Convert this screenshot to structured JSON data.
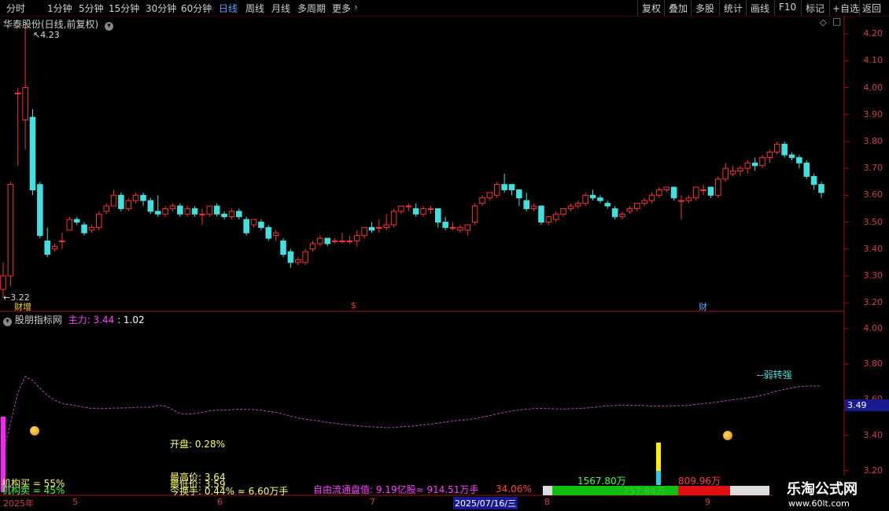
{
  "toolbar": {
    "periods": [
      "分时",
      "1分钟",
      "5分钟",
      "15分钟",
      "30分钟",
      "60分钟",
      "日线",
      "周线",
      "月线",
      "多周期",
      "更多"
    ],
    "active_period": "日线",
    "right_buttons": [
      "复权",
      "叠加",
      "多股",
      "统计",
      "画线",
      "F10",
      "标记",
      "+自选",
      "返回"
    ]
  },
  "main_chart": {
    "title": "华泰股份(日线,前复权)",
    "y_ticks": [
      "4.20",
      "4.10",
      "4.00",
      "3.90",
      "3.80",
      "3.70",
      "3.60",
      "3.50",
      "3.40",
      "3.30",
      "3.20"
    ],
    "high_label": "4.23",
    "low_label": "3.22",
    "markers": [
      {
        "text": "财增"
      },
      {
        "text": "$"
      },
      {
        "text": "财"
      }
    ],
    "colors": {
      "up": "#ff3030",
      "down": "#40e0e0",
      "axis": "#d04040",
      "bg": "#000000"
    }
  },
  "chart_data": {
    "type": "candlestick",
    "ylim": [
      3.18,
      4.25
    ],
    "candles": [
      [
        3.25,
        3.3,
        3.22,
        3.35
      ],
      [
        3.3,
        3.64,
        3.26,
        3.65
      ],
      [
        3.98,
        3.98,
        3.71,
        4.0
      ],
      [
        3.88,
        4.0,
        3.77,
        4.23
      ],
      [
        3.89,
        3.62,
        3.6,
        3.92
      ],
      [
        3.64,
        3.45,
        3.44,
        3.65
      ],
      [
        3.43,
        3.38,
        3.37,
        3.48
      ],
      [
        3.4,
        3.41,
        3.39,
        3.42
      ],
      [
        3.43,
        3.43,
        3.4,
        3.46
      ],
      [
        3.47,
        3.51,
        3.47,
        3.52
      ],
      [
        3.51,
        3.5,
        3.49,
        3.52
      ],
      [
        3.49,
        3.46,
        3.45,
        3.5
      ],
      [
        3.47,
        3.48,
        3.46,
        3.49
      ],
      [
        3.48,
        3.53,
        3.47,
        3.54
      ],
      [
        3.54,
        3.56,
        3.53,
        3.57
      ],
      [
        3.56,
        3.6,
        3.56,
        3.62
      ],
      [
        3.6,
        3.55,
        3.54,
        3.61
      ],
      [
        3.55,
        3.58,
        3.54,
        3.59
      ],
      [
        3.58,
        3.6,
        3.57,
        3.61
      ],
      [
        3.6,
        3.58,
        3.56,
        3.61
      ],
      [
        3.58,
        3.54,
        3.53,
        3.59
      ],
      [
        3.54,
        3.53,
        3.52,
        3.6
      ],
      [
        3.53,
        3.55,
        3.52,
        3.56
      ],
      [
        3.55,
        3.56,
        3.54,
        3.57
      ],
      [
        3.56,
        3.53,
        3.52,
        3.57
      ],
      [
        3.53,
        3.55,
        3.52,
        3.56
      ],
      [
        3.55,
        3.53,
        3.52,
        3.56
      ],
      [
        3.53,
        3.53,
        3.49,
        3.55
      ],
      [
        3.53,
        3.56,
        3.52,
        3.56
      ],
      [
        3.56,
        3.53,
        3.52,
        3.57
      ],
      [
        3.53,
        3.52,
        3.51,
        3.54
      ],
      [
        3.52,
        3.54,
        3.51,
        3.55
      ],
      [
        3.54,
        3.52,
        3.51,
        3.55
      ],
      [
        3.51,
        3.46,
        3.45,
        3.52
      ],
      [
        3.49,
        3.51,
        3.48,
        3.51
      ],
      [
        3.5,
        3.48,
        3.47,
        3.51
      ],
      [
        3.48,
        3.44,
        3.43,
        3.49
      ],
      [
        3.45,
        3.46,
        3.43,
        3.47
      ],
      [
        3.43,
        3.38,
        3.37,
        3.44
      ],
      [
        3.39,
        3.35,
        3.33,
        3.4
      ],
      [
        3.35,
        3.36,
        3.34,
        3.37
      ],
      [
        3.35,
        3.39,
        3.34,
        3.4
      ],
      [
        3.4,
        3.42,
        3.39,
        3.43
      ],
      [
        3.42,
        3.44,
        3.41,
        3.45
      ],
      [
        3.44,
        3.42,
        3.41,
        3.44
      ],
      [
        3.43,
        3.43,
        3.42,
        3.44
      ],
      [
        3.43,
        3.43,
        3.42,
        3.46
      ],
      [
        3.43,
        3.43,
        3.42,
        3.45
      ],
      [
        3.43,
        3.45,
        3.41,
        3.47
      ],
      [
        3.45,
        3.48,
        3.44,
        3.48
      ],
      [
        3.48,
        3.47,
        3.46,
        3.5
      ],
      [
        3.48,
        3.48,
        3.46,
        3.51
      ],
      [
        3.48,
        3.49,
        3.47,
        3.53
      ],
      [
        3.49,
        3.54,
        3.48,
        3.55
      ],
      [
        3.54,
        3.56,
        3.53,
        3.56
      ],
      [
        3.56,
        3.56,
        3.54,
        3.57
      ],
      [
        3.55,
        3.53,
        3.52,
        3.57
      ],
      [
        3.53,
        3.55,
        3.52,
        3.56
      ],
      [
        3.55,
        3.55,
        3.53,
        3.56
      ],
      [
        3.55,
        3.5,
        3.48,
        3.55
      ],
      [
        3.5,
        3.48,
        3.47,
        3.52
      ],
      [
        3.48,
        3.48,
        3.47,
        3.5
      ],
      [
        3.47,
        3.48,
        3.46,
        3.49
      ],
      [
        3.47,
        3.49,
        3.45,
        3.49
      ],
      [
        3.5,
        3.56,
        3.49,
        3.57
      ],
      [
        3.57,
        3.59,
        3.56,
        3.6
      ],
      [
        3.59,
        3.61,
        3.58,
        3.61
      ],
      [
        3.6,
        3.64,
        3.59,
        3.65
      ],
      [
        3.64,
        3.62,
        3.61,
        3.68
      ],
      [
        3.64,
        3.62,
        3.6,
        3.64
      ],
      [
        3.62,
        3.59,
        3.56,
        3.62
      ],
      [
        3.58,
        3.55,
        3.54,
        3.61
      ],
      [
        3.55,
        3.56,
        3.54,
        3.57
      ],
      [
        3.56,
        3.5,
        3.49,
        3.56
      ],
      [
        3.5,
        3.52,
        3.49,
        3.52
      ],
      [
        3.51,
        3.53,
        3.5,
        3.54
      ],
      [
        3.53,
        3.55,
        3.52,
        3.55
      ],
      [
        3.55,
        3.56,
        3.54,
        3.57
      ],
      [
        3.56,
        3.57,
        3.55,
        3.58
      ],
      [
        3.57,
        3.6,
        3.56,
        3.61
      ],
      [
        3.6,
        3.59,
        3.58,
        3.62
      ],
      [
        3.59,
        3.58,
        3.57,
        3.6
      ],
      [
        3.57,
        3.56,
        3.55,
        3.58
      ],
      [
        3.55,
        3.52,
        3.51,
        3.56
      ],
      [
        3.52,
        3.53,
        3.51,
        3.54
      ],
      [
        3.54,
        3.55,
        3.53,
        3.56
      ],
      [
        3.55,
        3.57,
        3.54,
        3.57
      ],
      [
        3.57,
        3.58,
        3.56,
        3.59
      ],
      [
        3.58,
        3.6,
        3.57,
        3.61
      ],
      [
        3.6,
        3.62,
        3.59,
        3.63
      ],
      [
        3.62,
        3.63,
        3.61,
        3.63
      ],
      [
        3.63,
        3.59,
        3.58,
        3.63
      ],
      [
        3.58,
        3.58,
        3.51,
        3.6
      ],
      [
        3.58,
        3.59,
        3.57,
        3.6
      ],
      [
        3.59,
        3.63,
        3.58,
        3.63
      ],
      [
        3.62,
        3.62,
        3.6,
        3.64
      ],
      [
        3.63,
        3.6,
        3.59,
        3.63
      ],
      [
        3.6,
        3.66,
        3.59,
        3.67
      ],
      [
        3.66,
        3.7,
        3.65,
        3.72
      ],
      [
        3.68,
        3.69,
        3.67,
        3.71
      ],
      [
        3.69,
        3.7,
        3.67,
        3.71
      ],
      [
        3.7,
        3.72,
        3.68,
        3.73
      ],
      [
        3.72,
        3.71,
        3.69,
        3.74
      ],
      [
        3.71,
        3.74,
        3.7,
        3.75
      ],
      [
        3.74,
        3.76,
        3.72,
        3.77
      ],
      [
        3.76,
        3.79,
        3.75,
        3.8
      ],
      [
        3.79,
        3.75,
        3.74,
        3.8
      ],
      [
        3.75,
        3.74,
        3.73,
        3.76
      ],
      [
        3.74,
        3.72,
        3.7,
        3.75
      ],
      [
        3.72,
        3.67,
        3.66,
        3.73
      ],
      [
        3.67,
        3.64,
        3.62,
        3.68
      ],
      [
        3.64,
        3.61,
        3.59,
        3.65
      ]
    ]
  },
  "indicator": {
    "title": "股朋指标网",
    "series_label": "主力: 3.44",
    "series_value2": ": 1.02",
    "y_ticks": [
      "4.00",
      "3.80",
      "3.60",
      "3.40",
      "3.20"
    ],
    "current_value": "3.49",
    "note_weak_strong": "--弱转强",
    "open_text": "开盘: 0.28%",
    "high_price": "最高价: 3.64",
    "low_price": "最低价: 3.59",
    "turnover": "今换手: 0.44% ≈ 6.60万手",
    "inst_buy": "机构买 = 55%",
    "inst_sell": "机构卖 = 45%",
    "free_float": "自由流通盘值: 9.19亿股≈ 914.51万手",
    "pct": "34.06%",
    "buy_vol": "1567.80万",
    "sell_vol": "809.96万",
    "mid_vol": "757.84万",
    "dates": [
      "2025年",
      "5",
      "6",
      "7",
      "2025/07/16/三",
      "8",
      "9"
    ]
  },
  "watermark": {
    "cn": "乐淘公式网",
    "url": "www.60lt.com"
  }
}
